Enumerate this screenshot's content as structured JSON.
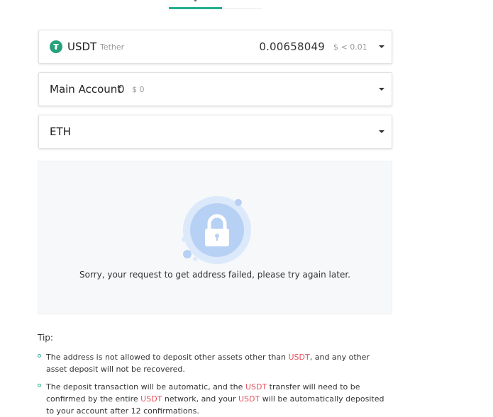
{
  "colors": {
    "accent": "#24ae8f",
    "highlight": "#e1525f",
    "coin": "#26a17b"
  },
  "coin_select": {
    "icon": "tether-icon",
    "symbol": "USDT",
    "name": "Tether",
    "balance": "0.00658049",
    "usd_value": "$ < 0.01"
  },
  "account_select": {
    "label": "Main Account",
    "balance": "0",
    "usd_value": "$ 0"
  },
  "network_select": {
    "label": "ETH"
  },
  "error": {
    "icon": "lock-icon",
    "message": "Sorry, your request to get address failed, please try again later."
  },
  "tips": {
    "title": "Tip:",
    "item1": {
      "a": "The address is not allowed to deposit other assets other than ",
      "coin": "USDT",
      "b": ", and any other asset deposit will not be recovered."
    },
    "item2": {
      "a": "The deposit transaction will be automatic, and the ",
      "coin1": "USDT",
      "b": " transfer will need to be confirmed by the entire ",
      "coin2": "USDT",
      "c": " network, and your ",
      "coin3": "USDT",
      "d": " will be automatically deposited to your account after 12 confirmations."
    }
  }
}
